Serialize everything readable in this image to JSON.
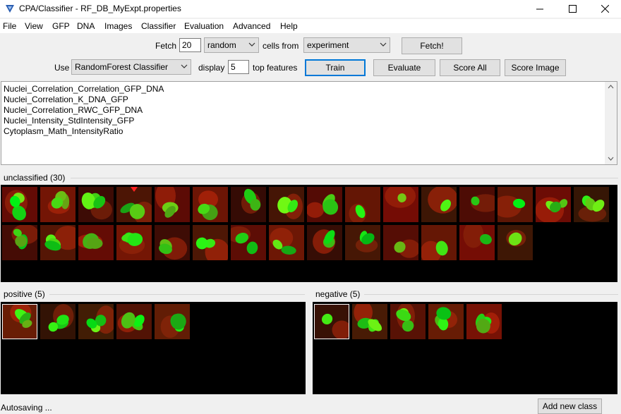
{
  "window": {
    "title": "CPA/Classifier - RF_DB_MyExpt.properties"
  },
  "menu": [
    "File",
    "View",
    "GFP",
    "DNA",
    "Images",
    "Classifier",
    "Evaluation",
    "Advanced",
    "Help"
  ],
  "fetch": {
    "label": "Fetch",
    "count": "20",
    "method": "random",
    "cells_from_label": "cells from",
    "source": "experiment",
    "button": "Fetch!"
  },
  "classifier": {
    "use_label": "Use",
    "type": "RandomForest Classifier",
    "display_label": "display",
    "display_count": "5",
    "top_features_label": "top features",
    "buttons": {
      "train": "Train",
      "evaluate": "Evaluate",
      "score_all": "Score All",
      "score_image": "Score Image"
    }
  },
  "features": [
    "Nuclei_Correlation_Correlation_GFP_DNA",
    "Nuclei_Correlation_K_DNA_GFP",
    "Nuclei_Correlation_RWC_GFP_DNA",
    "Nuclei_Intensity_StdIntensity_GFP",
    "Cytoplasm_Math_IntensityRatio"
  ],
  "bins": {
    "unclassified": {
      "label": "unclassified (30)",
      "count": 30
    },
    "positive": {
      "label": "positive (5)",
      "count": 5
    },
    "negative": {
      "label": "negative (5)",
      "count": 5
    }
  },
  "status": {
    "text": "Autosaving ...",
    "add_class_button": "Add new class"
  },
  "colors": {
    "accent": "#0078d7",
    "bin_bg": "#000000",
    "nucleus": "#2fd12f",
    "cytoplasm": "#8a1a0a"
  },
  "icons": [
    "app-icon",
    "minimize-icon",
    "maximize-icon",
    "close-icon",
    "dropdown-arrow-icon"
  ]
}
